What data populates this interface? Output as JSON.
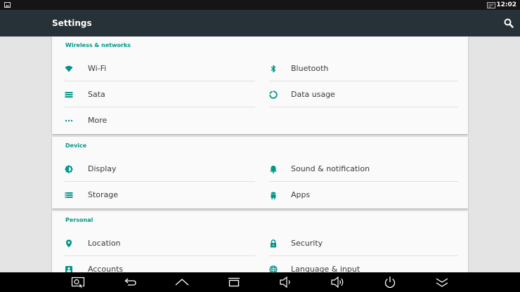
{
  "status_bar": {
    "time": "12:02",
    "left_icon": "image-icon",
    "right_icon": "cast-icon"
  },
  "action_bar": {
    "title": "Settings",
    "search_icon": "search-icon"
  },
  "colors": {
    "status_bar": "#151515",
    "action_bar": "#263238",
    "accent": "#009688",
    "background": "#e4e4e4",
    "card": "#fafafa",
    "nav_bar": "#000000"
  },
  "sections": [
    {
      "title": "Wireless & networks",
      "items": [
        {
          "label": "Wi-Fi",
          "icon": "wifi-icon"
        },
        {
          "label": "Bluetooth",
          "icon": "bluetooth-icon"
        },
        {
          "label": "Sata",
          "icon": "sata-icon"
        },
        {
          "label": "Data usage",
          "icon": "data-usage-icon"
        },
        {
          "label": "More",
          "icon": "more-icon"
        }
      ]
    },
    {
      "title": "Device",
      "items": [
        {
          "label": "Display",
          "icon": "brightness-icon"
        },
        {
          "label": "Sound & notification",
          "icon": "bell-icon"
        },
        {
          "label": "Storage",
          "icon": "storage-icon"
        },
        {
          "label": "Apps",
          "icon": "android-icon"
        }
      ]
    },
    {
      "title": "Personal",
      "items": [
        {
          "label": "Location",
          "icon": "location-icon"
        },
        {
          "label": "Security",
          "icon": "lock-icon"
        },
        {
          "label": "Accounts",
          "icon": "account-icon"
        },
        {
          "label": "Language & input",
          "icon": "globe-icon"
        }
      ]
    }
  ],
  "nav_bar": [
    {
      "name": "screenshot-icon"
    },
    {
      "name": "back-icon"
    },
    {
      "name": "home-icon"
    },
    {
      "name": "recent-apps-icon"
    },
    {
      "name": "volume-down-icon"
    },
    {
      "name": "volume-up-icon"
    },
    {
      "name": "power-icon"
    },
    {
      "name": "collapse-icon"
    }
  ]
}
